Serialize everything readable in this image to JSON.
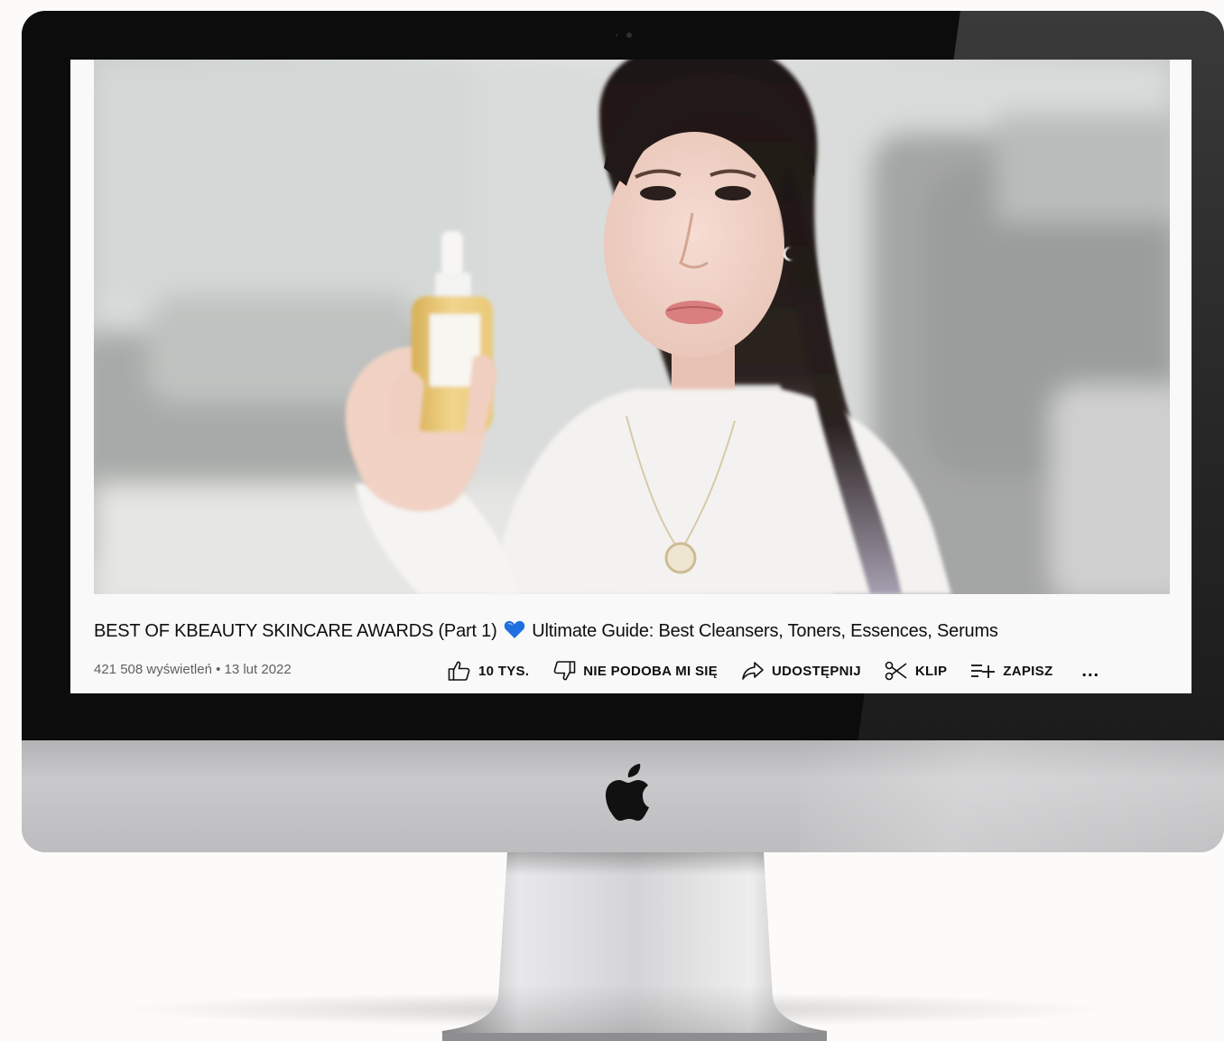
{
  "video": {
    "title_part1": "BEST OF KBEAUTY SKINCARE AWARDS (Part 1)",
    "title_part2": "Ultimate Guide: Best Cleansers, Toners, Essences, Serums",
    "title_emoji_icon": "blue-heart-icon",
    "meta": "421 508 wyświetleń • 13 lut 2022"
  },
  "actions": {
    "like": {
      "icon": "thumbs-up-icon",
      "label": "10 TYS."
    },
    "dislike": {
      "icon": "thumbs-down-icon",
      "label": "NIE PODOBA MI SIĘ"
    },
    "share": {
      "icon": "share-icon",
      "label": "UDOSTĘPNIJ"
    },
    "clip": {
      "icon": "scissors-icon",
      "label": "KLIP"
    },
    "save": {
      "icon": "playlist-add-icon",
      "label": "ZAPISZ"
    },
    "more": {
      "icon": "more-icon",
      "label": "..."
    }
  },
  "colors": {
    "screen_bg": "#f9f9f9",
    "text_primary": "#0f0f0f",
    "text_secondary": "#606060",
    "heart": "#1e6fe0",
    "bezel": "#0c0c0c"
  }
}
